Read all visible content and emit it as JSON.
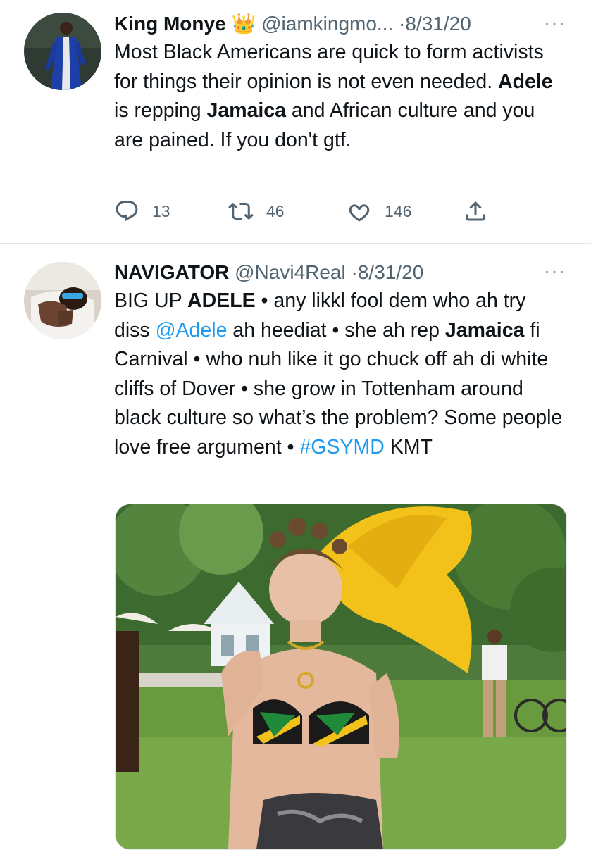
{
  "tweets": [
    {
      "name": "King Monye",
      "name_emoji": "👑",
      "handle": "@iamkingmo...",
      "separator": "·",
      "date": "8/31/20",
      "more": "···",
      "body": {
        "t1": "Most Black Americans are quick to form activists for things their opinion is not even needed. ",
        "b1": "Adele",
        "t2": " is repping ",
        "b2": "Jamaica",
        "t3": " and African culture and you are pained. If you don't gtf."
      },
      "reply_count": "13",
      "retweet_count": "46",
      "like_count": "146"
    },
    {
      "name": "NAVIGATOR",
      "handle": "@Navi4Real",
      "separator": "·",
      "date": "8/31/20",
      "more": "···",
      "body": {
        "t1": "BIG UP ",
        "b1": "ADELE",
        "t2": " • any likkl fool dem who ah try diss ",
        "link1": "@Adele",
        "t3": " ah heediat • she ah rep ",
        "b2": "Jamaica",
        "t4": " fi Carnival • who nuh like it go chuck off ah di white cliffs of Dover • she grow in Tottenham around black culture so what’s the problem? Some people love free argument • ",
        "link2": "#GSYMD",
        "t5": " KMT"
      }
    }
  ],
  "icons": [
    "reply-icon",
    "retweet-icon",
    "like-icon",
    "share-icon",
    "more-icon"
  ],
  "colors": {
    "text": "#0f1419",
    "secondary": "#536471",
    "link": "#1d9bf0",
    "divider": "#e1e6ea"
  }
}
